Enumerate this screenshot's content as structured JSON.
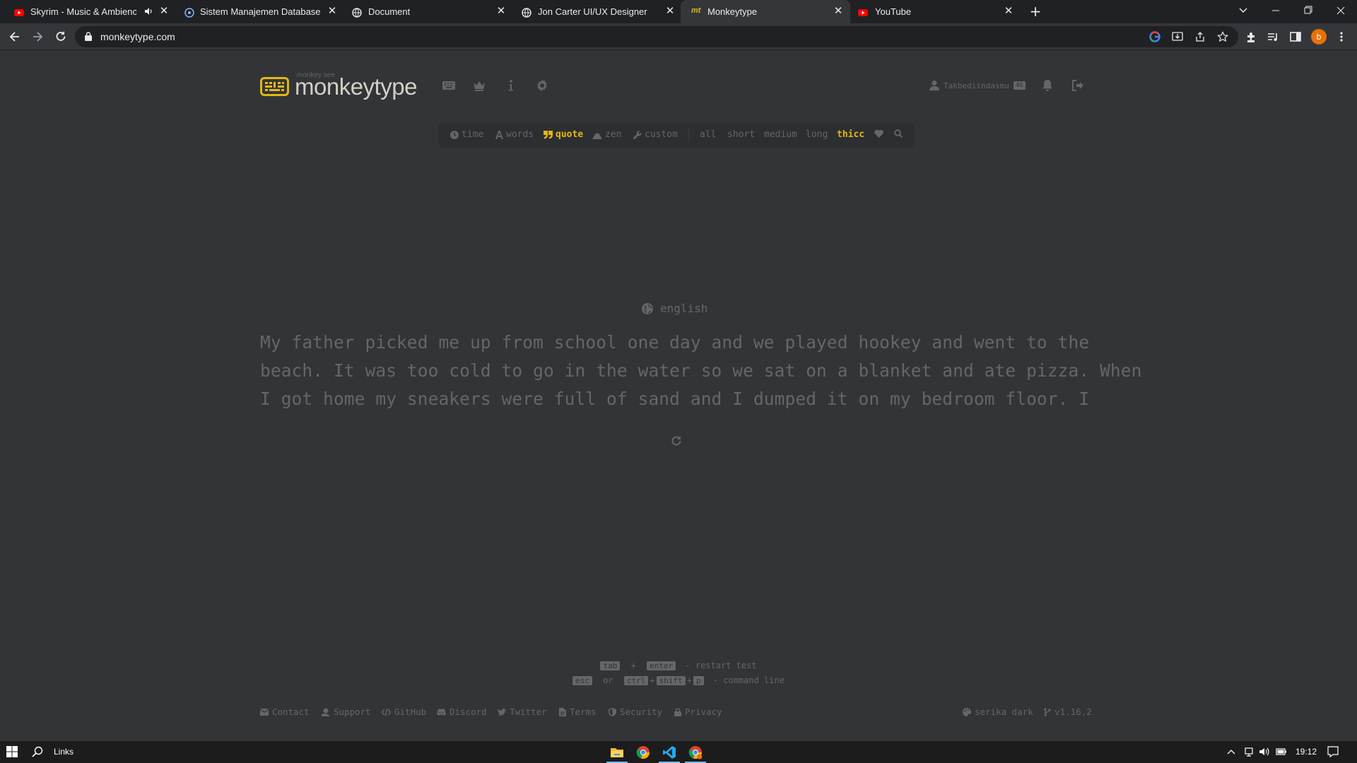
{
  "browser": {
    "tabs": [
      {
        "title": "Skyrim - Music & Ambience",
        "favicon": "youtube-icon",
        "audio": true,
        "active": false
      },
      {
        "title": "Sistem Manajemen Database Uni",
        "favicon": "globe-icon",
        "active": false
      },
      {
        "title": "Document",
        "favicon": "globe-icon",
        "active": false
      },
      {
        "title": "Jon Carter UI/UX Designer",
        "favicon": "globe-icon",
        "active": false
      },
      {
        "title": "Monkeytype",
        "favicon": "mt",
        "active": true
      },
      {
        "title": "YouTube",
        "favicon": "youtube-icon",
        "active": false
      }
    ],
    "new_tab": "+",
    "url": "monkeytype.com",
    "profile_initial": "b"
  },
  "app": {
    "logo_sub": "monkey see",
    "logo_text": "monkeytype",
    "account": {
      "username": "Takbediindasmu",
      "level": "46"
    },
    "modes": [
      {
        "label": "time",
        "icon": "clock-icon",
        "active": false
      },
      {
        "label": "words",
        "icon": "font-icon",
        "active": false
      },
      {
        "label": "quote",
        "icon": "quote-icon",
        "active": true
      },
      {
        "label": "zen",
        "icon": "mountain-icon",
        "active": false
      },
      {
        "label": "custom",
        "icon": "wrench-icon",
        "active": false
      }
    ],
    "lengths": [
      {
        "label": "all",
        "active": false
      },
      {
        "label": "short",
        "active": false
      },
      {
        "label": "medium",
        "active": false
      },
      {
        "label": "long",
        "active": false
      },
      {
        "label": "thicc",
        "active": true
      }
    ],
    "language": "english",
    "words_lines": [
      "My father picked me up from school one day and we played hookey and went to the",
      "beach. It was too cold to go in the water so we sat on a blanket and ate pizza. When",
      "I got home my sneakers were full of sand and I dumped it on my bedroom floor. I"
    ],
    "keytips": {
      "line1": {
        "key1": "tab",
        "plus": "+",
        "key2": "enter",
        "desc": "- restart test"
      },
      "line2": {
        "key1": "esc",
        "or": "or",
        "key2": "ctrl",
        "key3": "shift",
        "key4": "p",
        "plus": "+",
        "desc": "- command line"
      }
    },
    "footer": {
      "links": [
        "Contact",
        "Support",
        "GitHub",
        "Discord",
        "Twitter",
        "Terms",
        "Security",
        "Privacy"
      ],
      "theme": "serika dark",
      "version": "v1.16.2"
    }
  },
  "taskbar": {
    "search_label": "Links",
    "time": "19:12"
  },
  "colors": {
    "accent": "#e2b714",
    "background": "#323437",
    "sub": "#646669",
    "text": "#d1d0c5"
  }
}
